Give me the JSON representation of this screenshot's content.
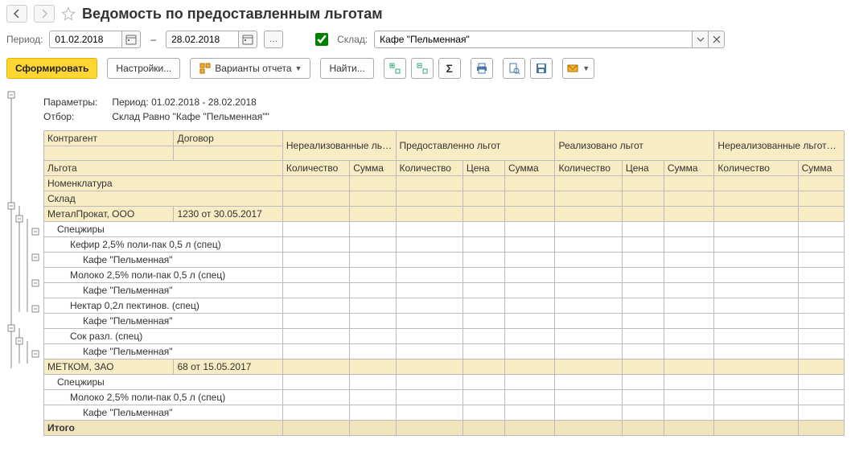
{
  "title": "Ведомость по предоставленным льготам",
  "filters": {
    "period_label": "Период:",
    "date_from": "01.02.2018",
    "date_to": "28.02.2018",
    "warehouse_label": "Склад:",
    "warehouse_value": "Кафе \"Пельменная\""
  },
  "toolbar": {
    "run": "Сформировать",
    "settings": "Настройки...",
    "variants": "Варианты отчета",
    "find": "Найти..."
  },
  "params": {
    "label1": "Параметры:",
    "value1": "Период: 01.02.2018 - 28.02.2018",
    "label2": "Отбор:",
    "value2": "Склад Равно \"Кафе \"Пельменная\"\""
  },
  "headers": {
    "contragent": "Контрагент",
    "contract": "Договор",
    "unreal_start": "Нереализованные льготы на начало",
    "granted": "Предоставленно льгот",
    "realized": "Реализовано льгот",
    "unreal_end": "Нереализованные льготы на конец",
    "benefit": "Льгота",
    "nomenclature": "Номенклатура",
    "warehouse": "Склад",
    "qty": "Количество",
    "sum": "Сумма",
    "price": "Цена",
    "total": "Итого"
  },
  "rows": [
    {
      "type": "l0",
      "c0": "МеталПрокат, ООО",
      "c1": "1230 от 30.05.2017"
    },
    {
      "type": "l1",
      "c0": "Спецжиры"
    },
    {
      "type": "l2",
      "c0": "Кефир 2,5% поли-пак 0,5 л (спец)"
    },
    {
      "type": "l3",
      "c0": "Кафе \"Пельменная\""
    },
    {
      "type": "l2",
      "c0": "Молоко 2,5% поли-пак 0,5 л (спец)"
    },
    {
      "type": "l3",
      "c0": "Кафе \"Пельменная\""
    },
    {
      "type": "l2",
      "c0": "Нектар 0,2л пектинов. (спец)"
    },
    {
      "type": "l3",
      "c0": "Кафе \"Пельменная\""
    },
    {
      "type": "l2",
      "c0": "Сок разл. (спец)"
    },
    {
      "type": "l3",
      "c0": "Кафе \"Пельменная\""
    },
    {
      "type": "l0",
      "c0": "МЕТКОМ, ЗАО",
      "c1": "68 от 15.05.2017"
    },
    {
      "type": "l1",
      "c0": "Спецжиры"
    },
    {
      "type": "l2",
      "c0": "Молоко 2,5% поли-пак 0,5 л (спец)"
    },
    {
      "type": "l3",
      "c0": "Кафе \"Пельменная\""
    }
  ]
}
